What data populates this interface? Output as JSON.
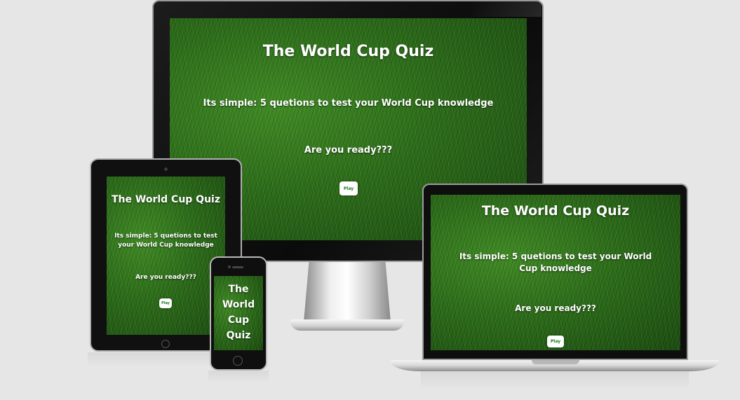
{
  "app": {
    "title": "The World Cup Quiz",
    "intro": "Its simple: 5 quetions to test your World Cup knowledge",
    "ready": "Are you ready???",
    "play_label": "Play"
  },
  "phone": {
    "title_lines": [
      "The",
      "World",
      "Cup",
      "Quiz"
    ]
  },
  "colors": {
    "background": "#e6e6e6",
    "grass": "#2b6b19",
    "button_text": "#1f7a1f",
    "text": "#ffffff"
  }
}
